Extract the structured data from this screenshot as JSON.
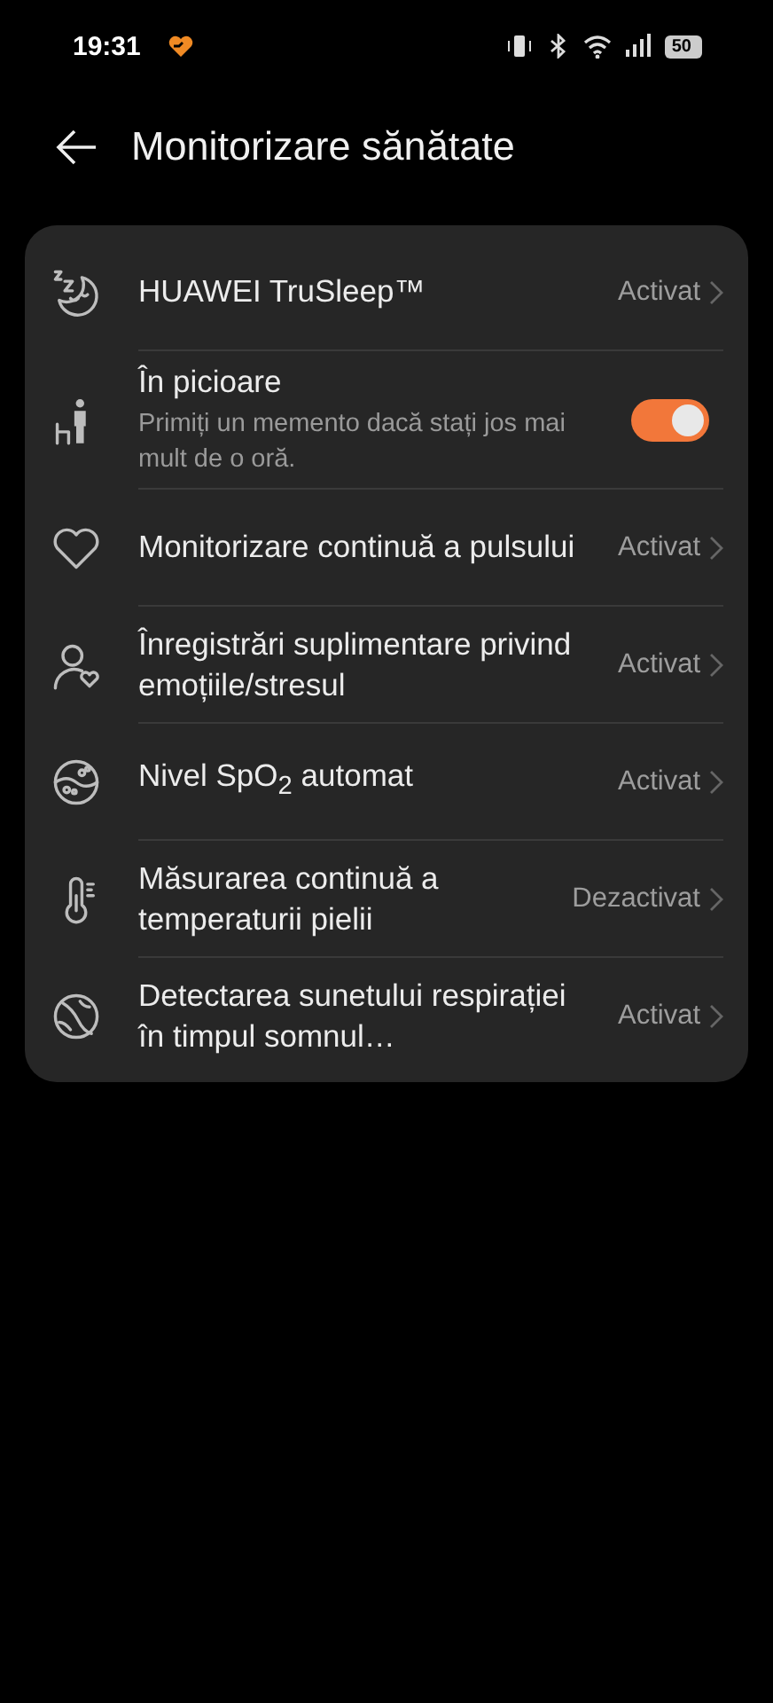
{
  "status_bar": {
    "time": "19:31",
    "battery": "50"
  },
  "header": {
    "title": "Monitorizare sănătate"
  },
  "items": [
    {
      "kind": "link",
      "title": "HUAWEI TruSleep™",
      "value": "Activat"
    },
    {
      "kind": "toggle",
      "title": "În picioare",
      "subtitle": "Primiți un memento dacă stați jos mai mult de o oră.",
      "on": true
    },
    {
      "kind": "link",
      "title": "Monitorizare continuă a pulsului",
      "value": "Activat"
    },
    {
      "kind": "link",
      "title": "Înregistrări suplimentare privind emoțiile/stresul",
      "value": "Activat"
    },
    {
      "kind": "link",
      "title": "Nivel SpO$_{2}$ automat",
      "value": "Activat"
    },
    {
      "kind": "link",
      "title": "Măsurarea continuă a temperaturii pielii",
      "value": "Dezactivat"
    },
    {
      "kind": "link",
      "title": "Detectarea sunetului respirației în timpul somnul…",
      "value": "Activat"
    }
  ]
}
